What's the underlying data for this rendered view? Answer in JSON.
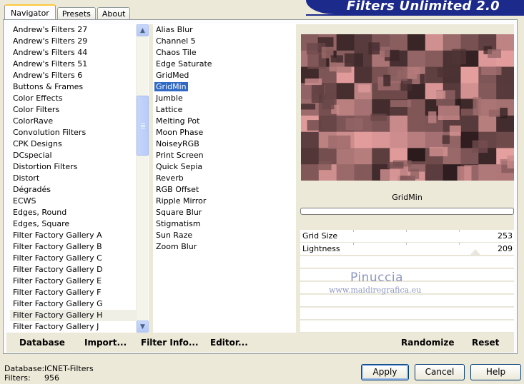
{
  "tabs": [
    "Navigator",
    "Presets",
    "About"
  ],
  "banner_title": "Filters Unlimited 2.0",
  "categories": {
    "items": [
      "Andrew's Filters 27",
      "Andrew's Filters 29",
      "Andrew's Filters 44",
      "Andrew's Filters 51",
      "Andrew's Filters 6",
      "Buttons & Frames",
      "Color Effects",
      "Color Filters",
      "ColorRave",
      "Convolution Filters",
      "CPK Designs",
      "DCspecial",
      "Distortion Filters",
      "Distort",
      "Dégradés",
      "ECWS",
      "Edges, Round",
      "Edges, Square",
      "Filter Factory Gallery A",
      "Filter Factory Gallery B",
      "Filter Factory Gallery C",
      "Filter Factory Gallery D",
      "Filter Factory Gallery E",
      "Filter Factory Gallery F",
      "Filter Factory Gallery G",
      "Filter Factory Gallery H",
      "Filter Factory Gallery J"
    ],
    "highlighted": "Filter Factory Gallery H"
  },
  "filters": {
    "items": [
      "Alias Blur",
      "Channel 5",
      "Chaos Tile",
      "Edge Saturate",
      "GridMed",
      "GridMin",
      "Jumble",
      "Lattice",
      "Melting Pot",
      "Moon Phase",
      "NoiseyRGB",
      "Print Screen",
      "Quick Sepia",
      "Reverb",
      "RGB Offset",
      "Ripple Mirror",
      "Square Blur",
      "Stigmatism",
      "Sun Raze",
      "Zoom Blur"
    ],
    "selected": "GridMin"
  },
  "left_buttons": {
    "database": "Database",
    "import": "Import...",
    "filter_info": "Filter Info...",
    "editor": "Editor..."
  },
  "right_buttons": {
    "randomize": "Randomize",
    "reset": "Reset"
  },
  "current_filter": "GridMin",
  "params": [
    {
      "label": "Grid Size",
      "value": "253"
    },
    {
      "label": "Lightness",
      "value": "209"
    }
  ],
  "watermark": {
    "name": "Pinuccia",
    "url": "www.maidiregrafica.eu"
  },
  "status": {
    "database_label": "Database:",
    "database_value": "ICNET-Filters",
    "filters_label": "Filters:",
    "filters_value": "956"
  },
  "dialog": {
    "apply": "Apply",
    "cancel": "Cancel",
    "help": "Help"
  },
  "colors": {
    "banner": "#1c2a8c",
    "selection": "#316ac5",
    "preview_pink": "#e8a0a0",
    "preview_dark": "#2a1a1c"
  },
  "icons": {
    "scroll_up": "chevron-up-icon",
    "scroll_down": "chevron-down-icon"
  }
}
